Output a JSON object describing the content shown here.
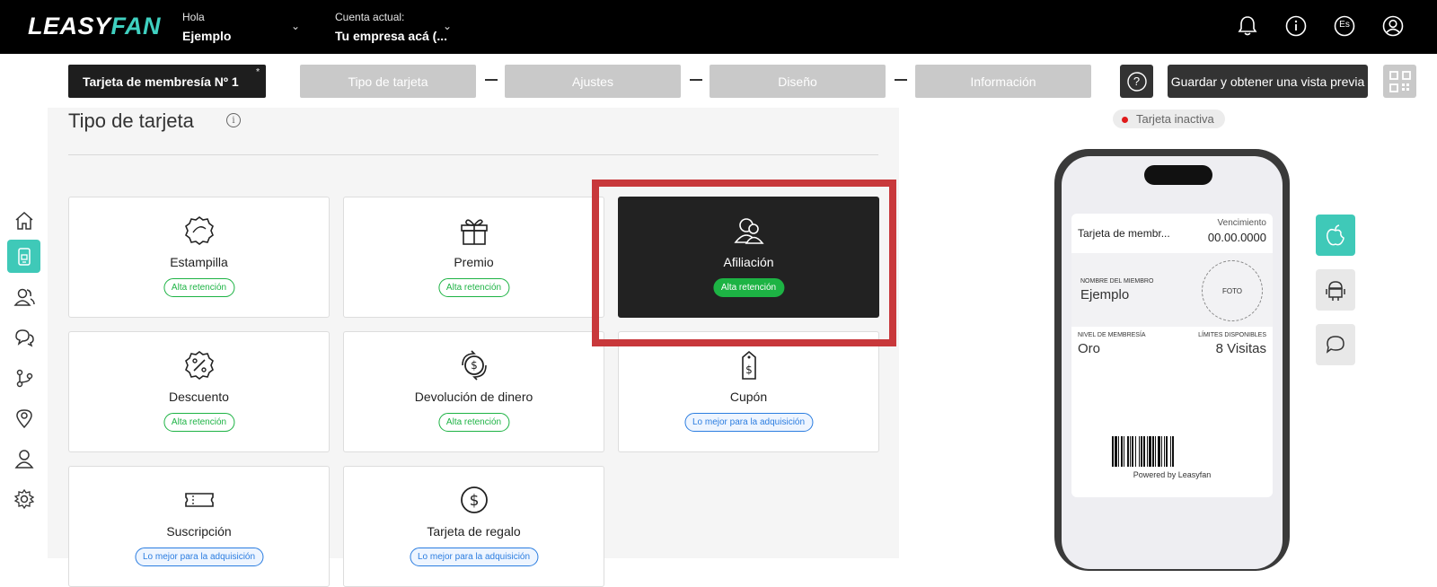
{
  "header": {
    "logo_a": "LEASY",
    "logo_b": "FAN",
    "greeting_label": "Hola",
    "user_name": "Ejemplo",
    "account_label": "Cuenta actual:",
    "account_name": "Tu empresa acá (...",
    "icons": [
      "bell-icon",
      "info-icon",
      "language-icon",
      "user-icon"
    ],
    "language": "Es"
  },
  "wizard": {
    "card_name": "Tarjeta de membresía Nº 1",
    "asterisk": "*",
    "steps": [
      "Tipo de tarjeta",
      "Ajustes",
      "Diseño",
      "Información"
    ],
    "help": "?",
    "save_label": "Guardar y obtener una vista previa"
  },
  "sidebar": {
    "items": [
      "home-icon",
      "card-icon",
      "users-icon",
      "chat-icon",
      "flow-icon",
      "location-icon",
      "profile-icon",
      "settings-icon"
    ],
    "active": "card-icon"
  },
  "main": {
    "title": "Tipo de tarjeta",
    "info": "i",
    "tiles": [
      {
        "name": "Estampilla",
        "badge": "Alta retención"
      },
      {
        "name": "Premio",
        "badge": "Alta retención"
      },
      {
        "name": "Afiliación",
        "badge": "Alta retención"
      },
      {
        "name": "Descuento",
        "badge": "Alta retención"
      },
      {
        "name": "Devolución de dinero",
        "badge": "Alta retención"
      },
      {
        "name": "Cupón",
        "badge": "Lo mejor para la adquisición"
      },
      {
        "name": "Suscripción",
        "badge": "Lo mejor para la adquisición"
      },
      {
        "name": "Tarjeta de regalo",
        "badge": "Lo mejor para la adquisición"
      }
    ],
    "selected": "Afiliación"
  },
  "preview": {
    "status": "Tarjeta inactiva",
    "pass_title": "Tarjeta de membr...",
    "expiry_label": "Vencimiento",
    "expiry_value": "00.00.0000",
    "member_label": "NOMBRE DEL MIEMBRO",
    "member_value": "Ejemplo",
    "photo": "FOTO",
    "level_label": "NIVEL DE MEMBRESÍA",
    "level_value": "Oro",
    "limits_label": "LÍMITES DISPONIBLES",
    "limits_value": "8 Visitas",
    "powered": "Powered by Leasyfan"
  },
  "platforms": [
    "apple-icon",
    "android-icon",
    "message-icon"
  ],
  "colors": {
    "accent": "#3fc9b8",
    "green": "#1db344",
    "blue": "#2b7de0",
    "highlight": "#c8383b"
  }
}
